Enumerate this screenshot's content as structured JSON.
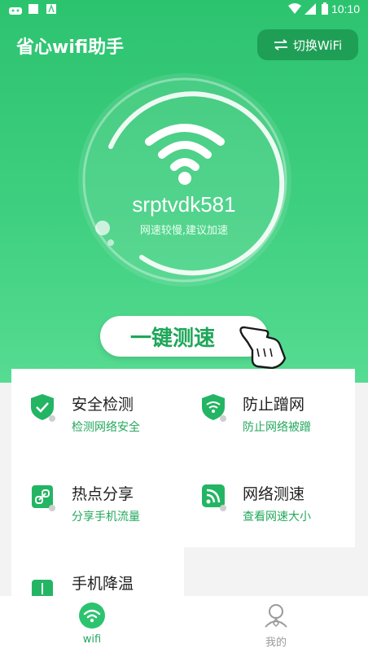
{
  "status": {
    "time": "10:10",
    "icons": [
      "android-icon",
      "square-icon",
      "font-icon",
      "wifi-signal-icon",
      "cell-signal-icon",
      "battery-icon"
    ]
  },
  "header": {
    "title": "省心wifi助手",
    "switch_label": "切换WiFi",
    "switch_icon": "swap-arrows-icon"
  },
  "wifi": {
    "ssid": "srptvdk581",
    "hint": "网速较慢,建议加速"
  },
  "actions": {
    "speed_test": "一键测速"
  },
  "features": [
    {
      "name": "安全检测",
      "sub": "检测网络安全",
      "icon": "shield-check-icon"
    },
    {
      "name": "防止蹭网",
      "sub": "防止网络被蹭",
      "icon": "shield-wifi-icon"
    },
    {
      "name": "热点分享",
      "sub": "分享手机流量",
      "icon": "link-icon"
    },
    {
      "name": "网络测速",
      "sub": "查看网速大小",
      "icon": "rss-icon"
    },
    {
      "name": "手机降温",
      "sub": "",
      "icon": "thermometer-icon"
    }
  ],
  "tabs": [
    {
      "label": "wifi",
      "icon": "wifi-tab-icon",
      "active": true
    },
    {
      "label": "我的",
      "icon": "profile-icon",
      "active": false
    }
  ],
  "colors": {
    "primary": "#2cc36f",
    "accent_text": "#23a85c",
    "inactive": "#9a9a9a"
  }
}
